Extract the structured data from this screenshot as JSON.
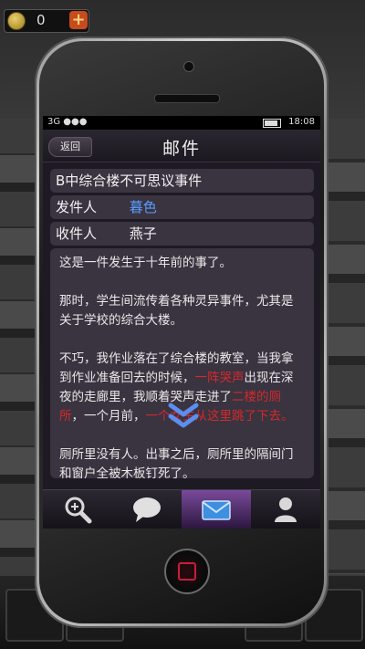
{
  "hud": {
    "coins": "0",
    "add_symbol": "+"
  },
  "status_bar": {
    "signal": "3G ●●●",
    "time": "18:08"
  },
  "nav": {
    "back_label": "返回",
    "title": "邮件"
  },
  "mail": {
    "subject": "B中综合楼不可思议事件",
    "sender_label": "发件人",
    "sender": "暮色",
    "recipient_label": "收件人",
    "recipient": "燕子",
    "paragraphs": {
      "p1": "这是一件发生于十年前的事了。",
      "p2": "那时，学生间流传着各种灵异事件，尤其是关于学校的综合大楼。",
      "p3_a": "不巧，我作业落在了综合楼的教室，当我拿到作业准备回去的时候，",
      "p3_red1": "一阵哭声",
      "p3_b": "出现在深夜的走廊里，我顺着哭声走进了",
      "p3_red2": "二楼的厕所",
      "p3_c": "，一个月前，",
      "p3_red3": "一个女生从这里跳了下去。",
      "p4": "厕所里没有人。出事之后，厕所里的隔间门和窗户全被木板钉死了。"
    }
  },
  "tabs": [
    {
      "icon": "zoom-icon",
      "active": false
    },
    {
      "icon": "chat-icon",
      "active": false
    },
    {
      "icon": "mail-icon",
      "active": true
    },
    {
      "icon": "contacts-icon",
      "active": false
    }
  ],
  "colors": {
    "accent_red": "#d42a2a",
    "accent_blue": "#5a9cff",
    "active_tab": "#7a4a9a"
  }
}
